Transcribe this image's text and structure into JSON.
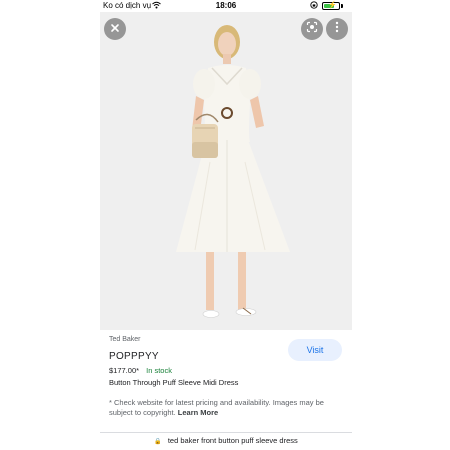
{
  "status_bar": {
    "carrier": "Ko có dịch vụ",
    "time": "18:06",
    "battery_level": 0.7,
    "icons": [
      "wifi-icon",
      "rotation-lock-icon",
      "charging-battery-icon"
    ]
  },
  "image_viewer": {
    "close_icon": "close-icon",
    "lens_icon": "lens-icon",
    "menu_icon": "more-vert-icon"
  },
  "product": {
    "brand": "Ted Baker",
    "name": "POPPPYY",
    "price": "$177.00*",
    "stock_status": "In stock",
    "description": "Button Through Puff Sleeve Midi Dress",
    "visit_label": "Visit",
    "disclaimer": "* Check website for latest pricing and availability. Images may be subject to copyright.",
    "learn_more_label": "Learn More"
  },
  "address_bar": {
    "url_text": "ted baker front button puff sleeve dress"
  },
  "colors": {
    "accent_blue": "#1a73e8",
    "visit_bg": "#e8f0fe",
    "stock_green": "#188038",
    "photo_bg": "#efefef",
    "dress": "#f7f5ef"
  }
}
